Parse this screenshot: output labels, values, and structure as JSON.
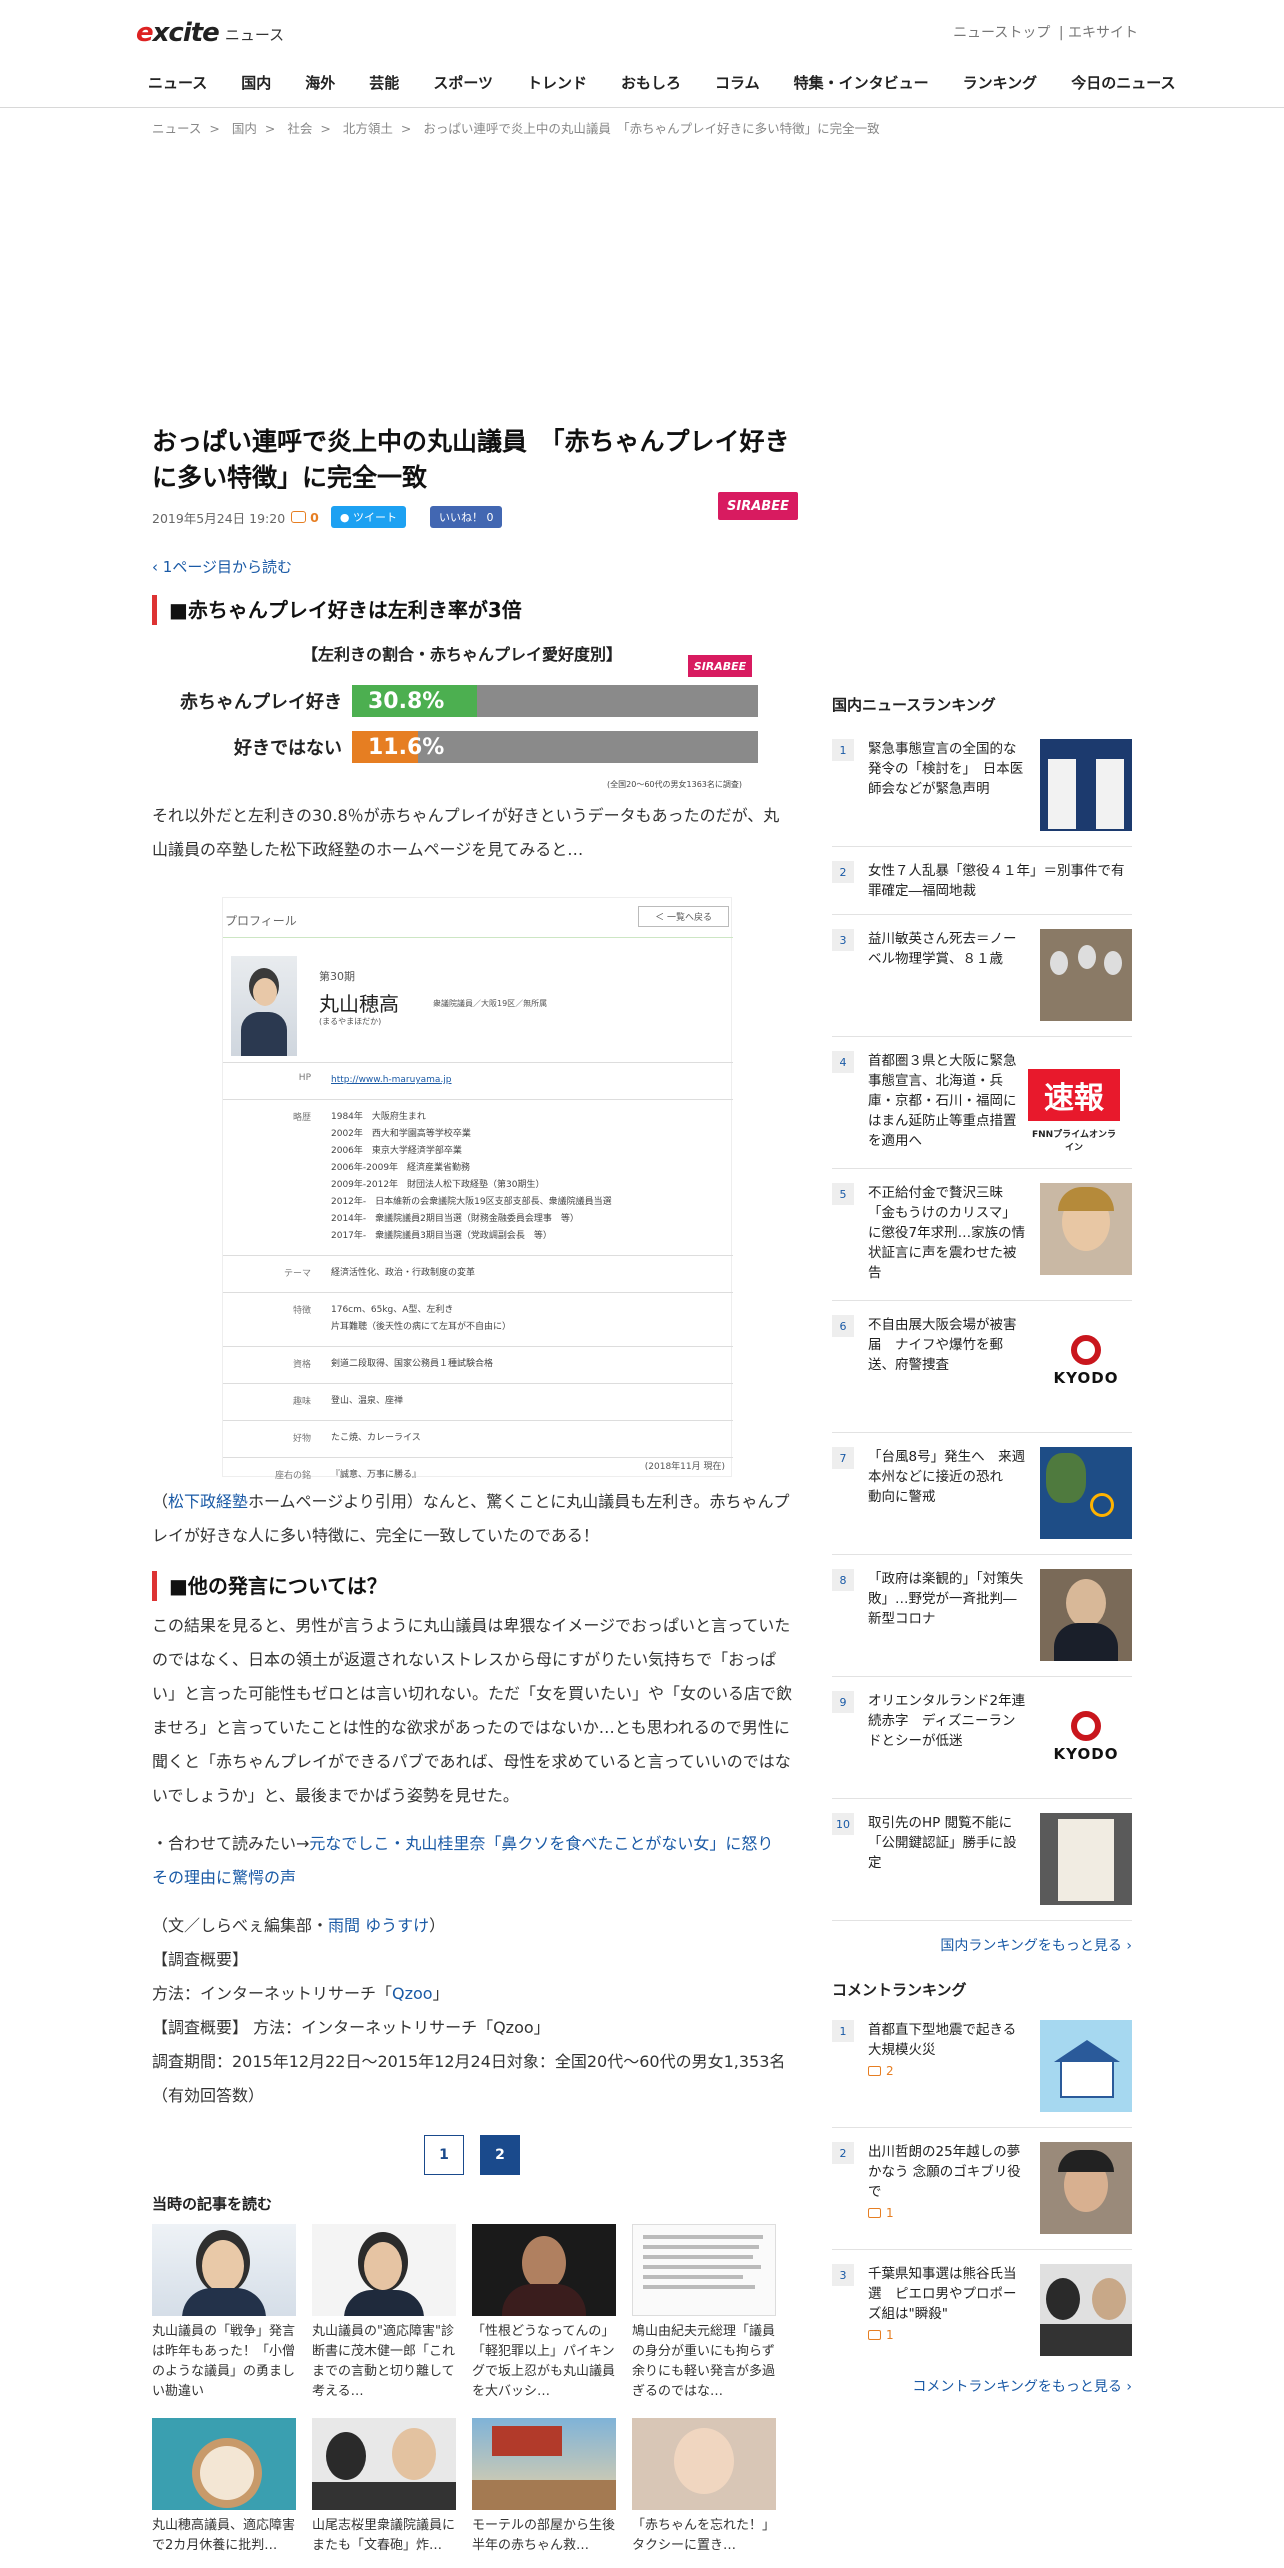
{
  "header": {
    "logo_brand": "excite",
    "logo_sub": "ニュース",
    "top_links": [
      "ニューストップ",
      "|",
      "エキサイト"
    ],
    "nav": [
      "ニュース",
      "国内",
      "海外",
      "芸能",
      "スポーツ",
      "トレンド",
      "おもしろ",
      "コラム",
      "特集・インタビュー",
      "ランキング",
      "今日のニュース"
    ]
  },
  "breadcrumb": [
    "ニュース",
    "国内",
    "社会",
    "北方領土",
    "おっぱい連呼で炎上中の丸山議員　「赤ちゃんプレイ好きに多い特徴」に完全一致"
  ],
  "article": {
    "title": "おっぱい連呼で炎上中の丸山議員　「赤ちゃんプレイ好きに多い特徴」に完全一致",
    "date": "2019年5月24日 19:20",
    "comment_count": "0",
    "tweet_label": "ツイート",
    "like_label": "いいね！ 0",
    "source_logo": "SIRABEE",
    "prev_link": "1ページ目から読む",
    "heading1": "■赤ちゃんプレイ好きは左利き率が3倍",
    "graph": {
      "title": "【左利きの割合・赤ちゃんプレイ愛好度別】",
      "logo": "SIRABEE",
      "note": "(全国20〜60代の男女1363名に調査)"
    },
    "para1": "それ以外だと左利きの30.8％が赤ちゃんプレイが好きというデータもあったのだが、丸山議員の卒塾した松下政経塾のホームページを見てみると…",
    "profile": {
      "header": "プロフィール",
      "back_btn": "＜ 一覧へ戻る",
      "term": "第30期",
      "name": "丸山穂高",
      "kana": "(まるやまほだか)",
      "role": "衆議院議員／大阪19区／無所属",
      "rows": [
        {
          "k": "HP",
          "v": [
            "http://www.h-maruyama.jp"
          ]
        },
        {
          "k": "略歴",
          "v": [
            "1984年　大阪府生まれ",
            "2002年　西大和学園高等学校卒業",
            "2006年　東京大学経済学部卒業",
            "2006年-2009年　経済産業省勤務",
            "2009年-2012年　財団法人松下政経塾（第30期生）",
            "2012年-　日本維新の会衆議院大阪19区支部支部長、衆議院議員当選",
            "2014年-　衆議院議員2期目当選（財務金融委員会理事　等）",
            "2017年-　衆議院議員3期目当選（党政調副会長　等）"
          ]
        },
        {
          "k": "テーマ",
          "v": [
            "経済活性化、政治・行政制度の変革"
          ]
        },
        {
          "k": "特徴",
          "v": [
            "176cm、65kg、A型、左利き",
            "片耳難聴（後天性の病にて左耳が不自由に）"
          ]
        },
        {
          "k": "資格",
          "v": [
            "剣道二段取得、国家公務員１種試験合格"
          ]
        },
        {
          "k": "趣味",
          "v": [
            "登山、温泉、座禅"
          ]
        },
        {
          "k": "好物",
          "v": [
            "たこ焼、カレーライス"
          ]
        },
        {
          "k": "座右の銘",
          "v": [
            "『誠意、万事に勝る』"
          ]
        }
      ],
      "date": "(2018年11月 現在)"
    },
    "para2_link": "松下政経塾",
    "para2_pre": "（",
    "para2_post": "ホームページより引用）なんと、驚くことに丸山議員も左利き。赤ちゃんプレイが好きな人に多い特徴に、完全に一致していたのである！",
    "heading2": "■他の発言については？",
    "para3": "この結果を見ると、男性が言うように丸山議員は卑猥なイメージでおっぱいと言っていたのではなく、日本の領土が返還されないストレスから母にすがりたい気持ちで「おっぱい」と言った可能性もゼロとは言い切れない。ただ「女を買いたい」や「女のいる店で飲ませろ」と言っていたことは性的な欲求があったのではないか…とも思われるので男性に聞くと「赤ちゃんプレイができるパブであれば、母性を求めていると言っていいのではないでしょうか」と、最後までかばう姿勢を見せた。",
    "read_also_prefix": "・合わせて読みたい→",
    "read_also_link": "元なでしこ・丸山桂里奈「鼻クソを食べたことがない女」に怒り　その理由に驚愕の声",
    "credit_pre": "（文／しらべぇ編集部・",
    "credit_link": "雨間 ゆうすけ",
    "credit_post": "）",
    "survey_head": "【調査概要】",
    "survey_method_pre": "方法：インターネットリサーチ「",
    "survey_method_link": "Qzoo",
    "survey_method_post": "」",
    "survey_line2": "【調査概要】 方法：インターネットリサーチ「Qzoo」",
    "survey_period": "調査期間：2015年12月22日～2015年12月24日対象：全国20代～60代の男女1,353名（有効回答数）",
    "pages": [
      "1",
      "2"
    ],
    "related_title": "当時の記事を読む",
    "related": [
      "丸山議員の「戦争」発言は昨年もあった！「小僧のような議員」の勇ましい勘違い",
      "丸山議員の\"適応障害\"診断書に茂木健一郎「これまでの言動と切り離して考える…",
      "「性根どうなってんの」「軽犯罪以上」パイキングで坂上忍がも丸山議員を大バッシ…",
      "鳩山由紀夫元総理「議員の身分が重いにも拘らず余りにも軽い発言が多過ぎるのではな…",
      "丸山穂高議員、適応障害で2カ月休養に批判…",
      "山尾志桜里衆議院議員にまたも「文春砲」炸…",
      "モーテルの部屋から生後半年の赤ちゃん救…",
      "「赤ちゃんを忘れた！」タクシーに置き…"
    ]
  },
  "sidebar": {
    "ranking_title": "国内ニュースランキング",
    "ranking": [
      {
        "n": "1",
        "t": "緊急事態宣言の全国的な発令の「検討を」　日本医師会などが緊急声明"
      },
      {
        "n": "2",
        "t": "女性７人乱暴「懲役４１年」＝別事件で有罪確定―福岡地裁"
      },
      {
        "n": "3",
        "t": "益川敏英さん死去＝ノーベル物理学賞、８１歳"
      },
      {
        "n": "4",
        "t": "首都圏３県と大阪に緊急事態宣言、北海道・兵庫・京都・石川・福岡にはまん延防止等重点措置を適用へ"
      },
      {
        "n": "5",
        "t": "不正給付金で贅沢三昧「金もうけのカリスマ」に懲役7年求刑…家族の情状証言に声を震わせた被告"
      },
      {
        "n": "6",
        "t": "不自由展大阪会場が被害届　ナイフや爆竹を郵送、府警捜査"
      },
      {
        "n": "7",
        "t": "「台風8号」発生へ　来週　本州などに接近の恐れ　動向に警戒"
      },
      {
        "n": "8",
        "t": "「政府は楽観的」「対策失敗」…野党が一斉批判―新型コロナ"
      },
      {
        "n": "9",
        "t": "オリエンタルランド2年連続赤字　ディズニーランドとシーが低迷"
      },
      {
        "n": "10",
        "t": "取引先のHP 閲覧不能に　「公開鍵認証」勝手に設定"
      }
    ],
    "kyodo_label": "KYODO",
    "sokuho_label": "速報",
    "sokuho_sub": "FNNプライムオンライン",
    "ranking_more": "国内ランキングをもっと見る",
    "comment_title": "コメントランキング",
    "comments": [
      {
        "n": "1",
        "t": "首都直下型地震で起きる大規模火災",
        "c": "2"
      },
      {
        "n": "2",
        "t": "出川哲朗の25年越しの夢かなう 念願のゴキブリ役で",
        "c": "1"
      },
      {
        "n": "3",
        "t": "千葉県知事選は熊谷氏当選　ピエロ男やプロポーズ組は\"瞬殺\"",
        "c": "1"
      }
    ],
    "comment_more": "コメントランキングをもっと見る"
  },
  "chart_data": {
    "type": "bar",
    "title": "【左利きの割合・赤ちゃんプレイ愛好度別】",
    "categories": [
      "赤ちゃんプレイ好き",
      "好きではない"
    ],
    "values": [
      30.8,
      11.6
    ],
    "value_labels": [
      "30.8%",
      "11.6%"
    ],
    "ylim": [
      0,
      100
    ],
    "colors": [
      "#4caf50",
      "#e67e22"
    ]
  }
}
